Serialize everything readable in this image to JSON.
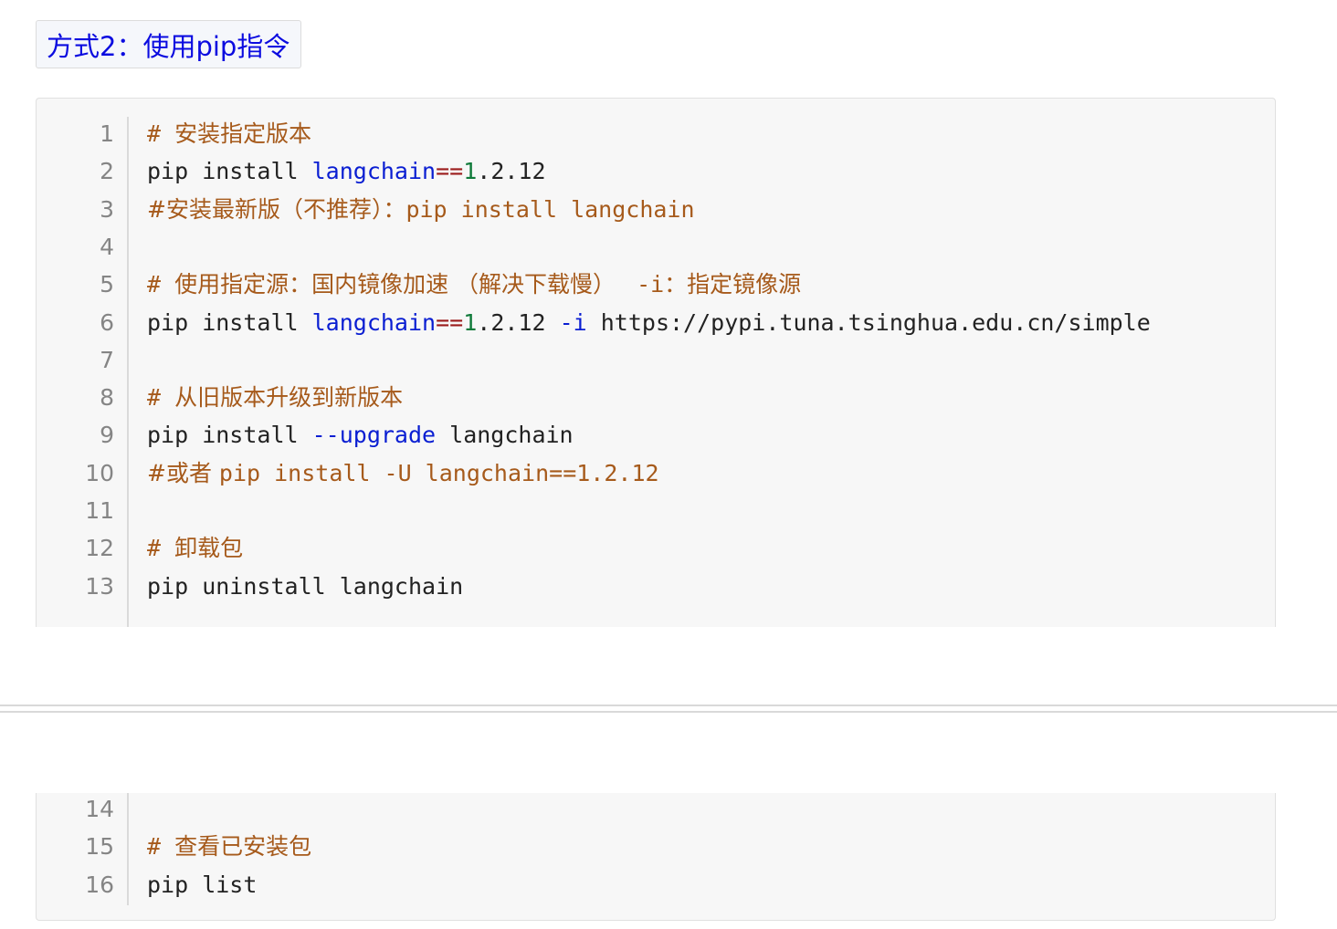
{
  "heading": "方式2：使用pip指令",
  "code": {
    "lines": [
      {
        "n": "1",
        "parts": [
          {
            "t": "# ",
            "c": "com"
          },
          {
            "t": "安装指定版本",
            "c": "com cjk"
          }
        ]
      },
      {
        "n": "2",
        "parts": [
          {
            "t": "pip install ",
            "c": ""
          },
          {
            "t": "langchain",
            "c": "kw"
          },
          {
            "t": "==",
            "c": "op"
          },
          {
            "t": "1",
            "c": "num"
          },
          {
            "t": ".2.12",
            "c": ""
          }
        ]
      },
      {
        "n": "3",
        "parts": [
          {
            "t": "#安装最新版（不推荐）：",
            "c": "com cjk"
          },
          {
            "t": "pip install langchain",
            "c": "com"
          }
        ]
      },
      {
        "n": "4",
        "parts": []
      },
      {
        "n": "5",
        "parts": [
          {
            "t": "# ",
            "c": "com"
          },
          {
            "t": "使用指定源：国内镜像加速 （解决下载慢） ",
            "c": "com cjk"
          },
          {
            "t": " -i",
            "c": "com"
          },
          {
            "t": "：指定镜像源",
            "c": "com cjk"
          }
        ]
      },
      {
        "n": "6",
        "parts": [
          {
            "t": "pip install ",
            "c": ""
          },
          {
            "t": "langchain",
            "c": "kw"
          },
          {
            "t": "==",
            "c": "op"
          },
          {
            "t": "1",
            "c": "num"
          },
          {
            "t": ".2.12 ",
            "c": ""
          },
          {
            "t": "-i",
            "c": "kw"
          },
          {
            "t": " https://pypi.tuna.tsinghua.edu.cn/simple",
            "c": ""
          }
        ]
      },
      {
        "n": "7",
        "parts": []
      },
      {
        "n": "8",
        "parts": [
          {
            "t": "# ",
            "c": "com"
          },
          {
            "t": "从旧版本升级到新版本",
            "c": "com cjk"
          }
        ]
      },
      {
        "n": "9",
        "parts": [
          {
            "t": "pip install ",
            "c": ""
          },
          {
            "t": "--upgrade",
            "c": "kw"
          },
          {
            "t": " langchain",
            "c": ""
          }
        ]
      },
      {
        "n": "10",
        "parts": [
          {
            "t": "#或者 ",
            "c": "com cjk"
          },
          {
            "t": "pip install -U langchain==1.2.12",
            "c": "com"
          }
        ]
      },
      {
        "n": "11",
        "parts": []
      },
      {
        "n": "12",
        "parts": [
          {
            "t": "# ",
            "c": "com"
          },
          {
            "t": "卸载包",
            "c": "com cjk"
          }
        ]
      },
      {
        "n": "13",
        "parts": [
          {
            "t": "pip uninstall langchain",
            "c": ""
          }
        ]
      }
    ],
    "lines2": [
      {
        "n": "14",
        "parts": []
      },
      {
        "n": "15",
        "parts": [
          {
            "t": "# ",
            "c": "com"
          },
          {
            "t": "查看已安装包",
            "c": "com cjk"
          }
        ]
      },
      {
        "n": "16",
        "parts": [
          {
            "t": "pip list",
            "c": ""
          }
        ]
      }
    ]
  }
}
